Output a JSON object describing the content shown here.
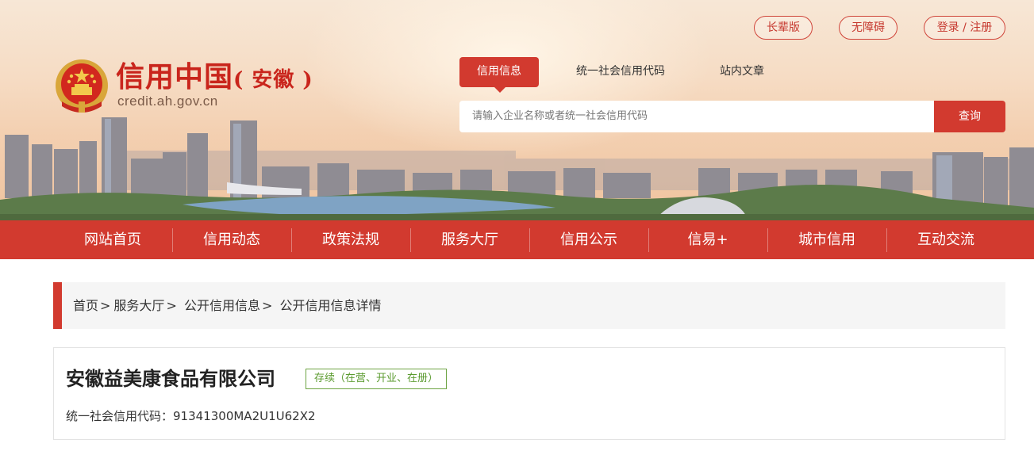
{
  "header": {
    "top_links": {
      "elder_mode": "长辈版",
      "accessibility": "无障碍",
      "login": "登录 / 注册"
    },
    "logo": {
      "title": "信用中国",
      "region": "( 安徽 )",
      "url": "credit.ah.gov.cn",
      "emblem_icon": "national-emblem-icon"
    },
    "search": {
      "tabs": [
        "信用信息",
        "统一社会信用代码",
        "站内文章"
      ],
      "active_tab": "信用信息",
      "placeholder": "请输入企业名称或者统一社会信用代码",
      "button_label": "查询"
    }
  },
  "nav": {
    "items": [
      "网站首页",
      "信用动态",
      "政策法规",
      "服务大厅",
      "信用公示",
      "信易+",
      "城市信用",
      "互动交流"
    ]
  },
  "breadcrumb": {
    "items": [
      "首页",
      "服务大厅",
      "公开信用信息",
      "公开信用信息详情"
    ],
    "separator": ">"
  },
  "company": {
    "name": "安徽益美康食品有限公司",
    "status": "存续（在营、开业、在册）",
    "credit_code_label": "统一社会信用代码：",
    "credit_code": "91341300MA2U1U62X2"
  },
  "colors": {
    "brand_red": "#d23a2f",
    "status_green": "#5a9a2e"
  }
}
